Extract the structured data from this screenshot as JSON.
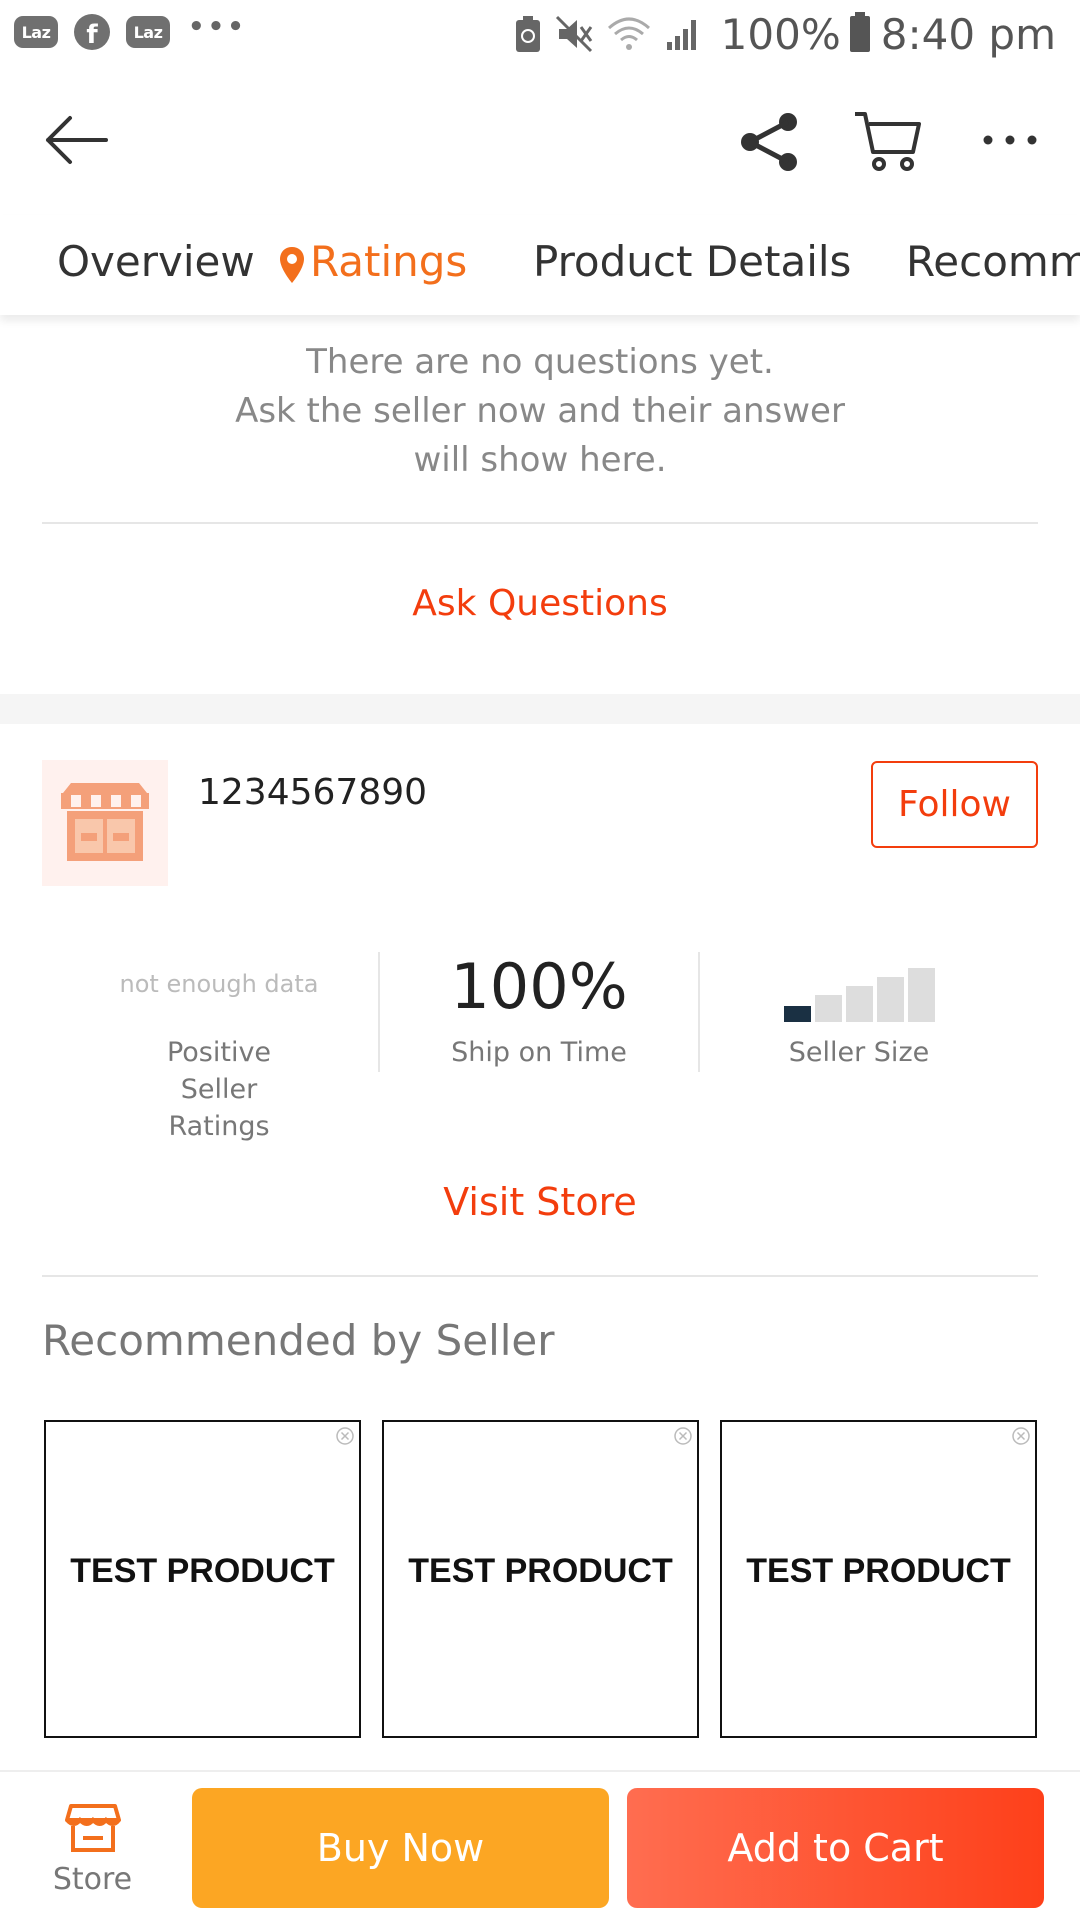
{
  "status_bar": {
    "app_icons": [
      "Laz",
      "facebook",
      "Laz"
    ],
    "battery_percent": "100%",
    "time": "8:40 pm"
  },
  "tabs": [
    {
      "label": "Overview"
    },
    {
      "label": "Ratings"
    },
    {
      "label": "Product Details"
    },
    {
      "label": "Recomm"
    }
  ],
  "questions": {
    "empty_lines": [
      "There are no questions yet.",
      "Ask the seller now and their answer",
      "will show here."
    ],
    "ask_label": "Ask Questions"
  },
  "seller": {
    "name": "1234567890",
    "follow_label": "Follow",
    "metrics": {
      "positive_ratings": {
        "value": "not enough data",
        "label": "Positive Seller Ratings"
      },
      "ship_on_time": {
        "value": "100%",
        "label": "Ship on Time"
      },
      "seller_size": {
        "level": 1,
        "max_level": 5,
        "label": "Seller Size"
      }
    },
    "visit_label": "Visit Store"
  },
  "recommended": {
    "title": "Recommended by Seller",
    "products": [
      {
        "name": "TEST PRODUCT"
      },
      {
        "name": "TEST PRODUCT"
      },
      {
        "name": "TEST PRODUCT"
      }
    ]
  },
  "bottom_bar": {
    "store_label": "Store",
    "buy_label": "Buy Now",
    "cart_label": "Add to Cart"
  },
  "colors": {
    "accent_orange": "#f36f1c",
    "link_red": "#f33d0d",
    "buy_now": "#fca623",
    "add_to_cart": "#fe401a",
    "seller_size_active": "#1a3043"
  }
}
